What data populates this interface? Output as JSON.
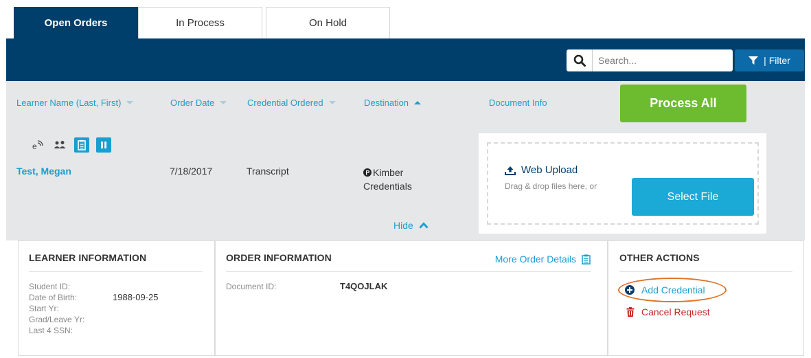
{
  "tabs": [
    {
      "label": "Open Orders",
      "active": true
    },
    {
      "label": "In Process",
      "active": false
    },
    {
      "label": "On Hold",
      "active": false
    }
  ],
  "toolbar": {
    "search_placeholder": "Search...",
    "filter_label": "| Filter"
  },
  "columns": {
    "learner": "Learner Name (Last, First)",
    "order_date": "Order Date",
    "credential": "Credential Ordered",
    "destination": "Destination",
    "document_info": "Document Info",
    "process_all": "Process All"
  },
  "order": {
    "icons": [
      "e-delivery-icon",
      "people-icon",
      "clipboard-icon",
      "pause-icon"
    ],
    "learner_name": "Test, Megan",
    "order_date": "7/18/2017",
    "credential": "Transcript",
    "destination_line1": "Kimber",
    "destination_line2": "Credentials",
    "hide_label": "Hide"
  },
  "upload": {
    "title": "Web Upload",
    "drag_text": "Drag & drop files here, or",
    "select_file": "Select File"
  },
  "learner_info": {
    "title": "LEARNER INFORMATION",
    "fields": [
      "Student ID:",
      "Date of Birth:",
      "Start Yr:",
      "Grad/Leave Yr:",
      "Last 4 SSN:"
    ],
    "dob_value": "1988-09-25"
  },
  "order_info": {
    "title": "ORDER INFORMATION",
    "more_details": "More Order Details",
    "document_id_label": "Document ID:",
    "document_id_value": "T4QOJLAK"
  },
  "other_actions": {
    "title": "OTHER ACTIONS",
    "add_credential": "Add Credential",
    "cancel_request": "Cancel Request"
  },
  "colors": {
    "navy": "#003e6b",
    "accent_blue": "#1a9ecf",
    "green": "#6dbb2e",
    "danger": "#c62828",
    "highlight": "#e0732a"
  }
}
